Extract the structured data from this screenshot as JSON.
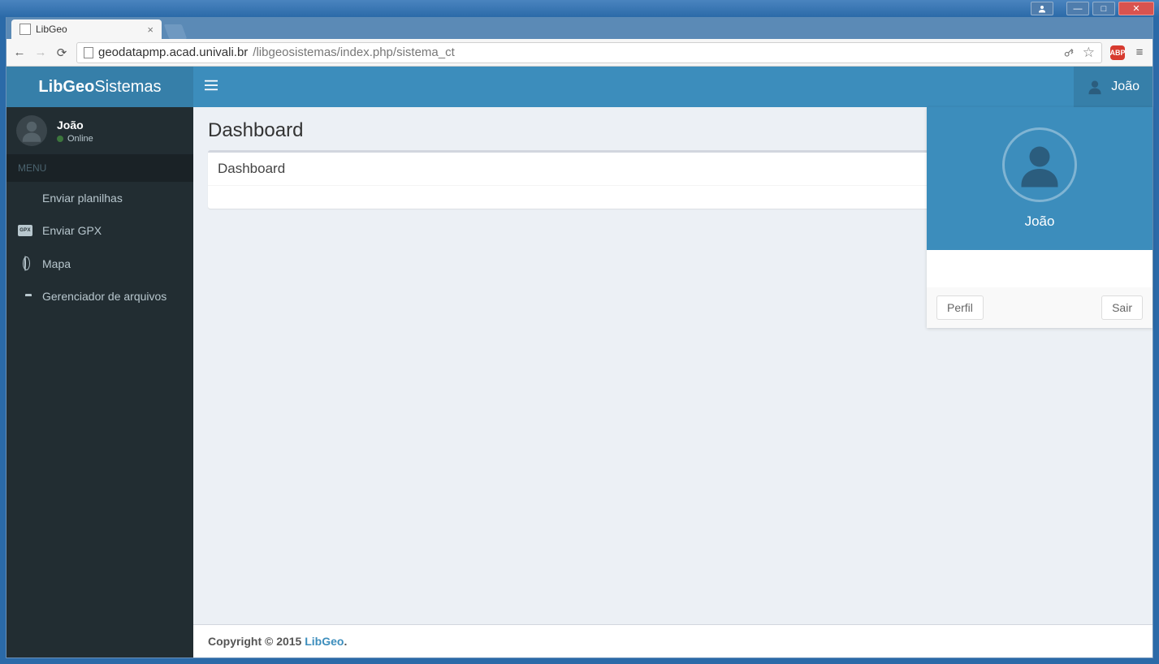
{
  "browser": {
    "tab_title": "LibGeo",
    "url_host": "geodatapmp.acad.univali.br",
    "url_path": "/libgeosistemas/index.php/sistema_ct",
    "ext_label": "ABP"
  },
  "header": {
    "logo_bold": "LibGeo",
    "logo_light": "Sistemas",
    "user_name": "João"
  },
  "sidebar": {
    "user_name": "João",
    "status_label": "Online",
    "menu_header": "MENU",
    "items": [
      {
        "label": "Enviar planilhas",
        "icon": "file"
      },
      {
        "label": "Enviar GPX",
        "icon": "gpx"
      },
      {
        "label": "Mapa",
        "icon": "globe"
      },
      {
        "label": "Gerenciador de arquivos",
        "icon": "folder"
      }
    ]
  },
  "content": {
    "page_title": "Dashboard",
    "box_title": "Dashboard"
  },
  "user_dropdown": {
    "name": "João",
    "profile_label": "Perfil",
    "logout_label": "Sair"
  },
  "footer": {
    "prefix": "Copyright © 2015 ",
    "link": "LibGeo",
    "suffix": "."
  }
}
